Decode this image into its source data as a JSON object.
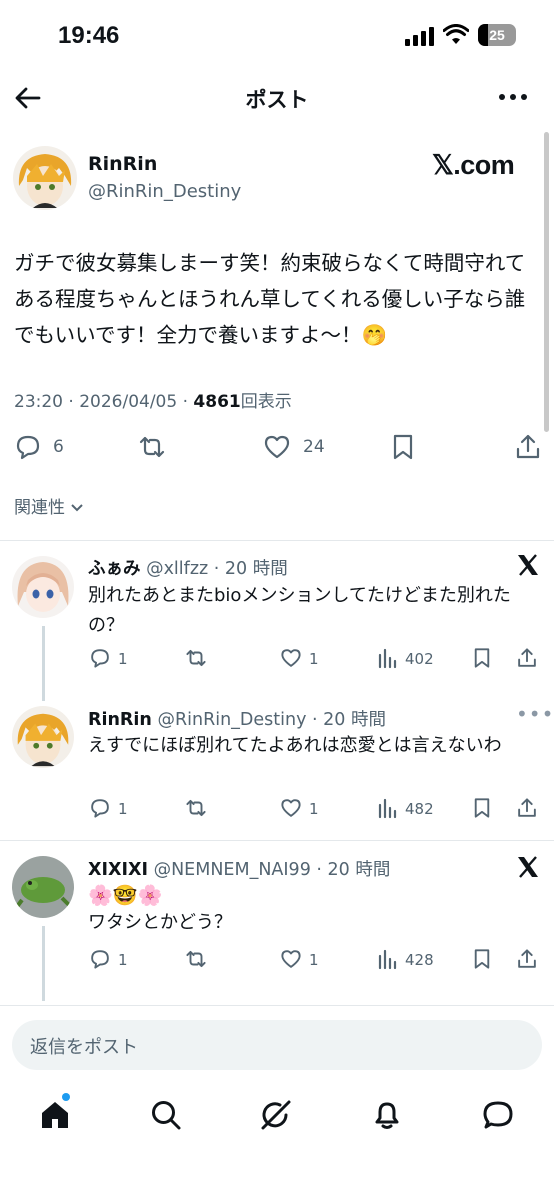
{
  "status_bar": {
    "time": "19:46",
    "battery": "25"
  },
  "header": {
    "title": "ポスト"
  },
  "post": {
    "display_name": "RinRin",
    "handle": "@RinRin_Destiny",
    "source_label": "𝕏.com",
    "text": "ガチで彼女募集しまーす笑！約束破らなくて時間守れてある程度ちゃんとほうれん草してくれる優しい子なら誰でもいいです！全力で養いますよ〜！🤭",
    "timestamp": "23:20 · 2026/04/05 · ",
    "views": "4861",
    "views_label": "回表示",
    "replies": "6",
    "likes": "24"
  },
  "sort_label": "関連性",
  "replies": [
    {
      "name": "ふぁみ",
      "handle": "@xllfzz · 20 時間",
      "text": "別れたあとまたbioメンションしてたけどまた別れたの？",
      "replies": "1",
      "likes": "1",
      "views": "402"
    },
    {
      "name": "RinRin",
      "handle": "@RinRin_Destiny · 20 時間",
      "text": "えすでにほぼ別れてたよあれは恋愛とは言えないわ",
      "replies": "1",
      "likes": "1",
      "views": "482"
    },
    {
      "name": "XIXIXI",
      "handle": "@NEMNEM_NAI99 · 20 時間",
      "emoji_line": "🌸🤓🌸",
      "text": "ワタシとかどう？",
      "replies": "1",
      "likes": "1",
      "views": "428"
    }
  ],
  "reply_bar": {
    "placeholder": "返信をポスト"
  },
  "tabs": [
    "home-icon",
    "search-icon",
    "grok-icon",
    "bell-icon",
    "messages-icon"
  ],
  "colors": {
    "accent": "#1d9bf0",
    "text": "#0f1419",
    "secondary": "#536471"
  }
}
